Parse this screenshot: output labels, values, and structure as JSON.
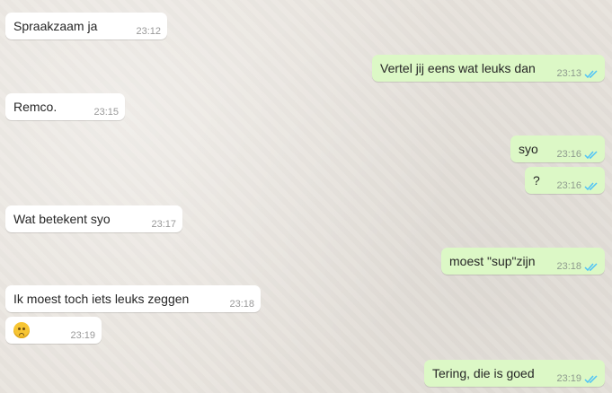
{
  "colors": {
    "incoming_bubble": "#ffffff",
    "outgoing_bubble": "#dcf8c6",
    "read_tick": "#4fc3f7"
  },
  "messages": [
    {
      "direction": "incoming",
      "text": "Spraakzaam ja",
      "time": "23:12"
    },
    {
      "direction": "outgoing",
      "text": "Vertel jij eens wat leuks dan",
      "time": "23:13",
      "status": "read"
    },
    {
      "direction": "incoming",
      "text": "Remco.",
      "time": "23:15"
    },
    {
      "direction": "outgoing",
      "text": "syo",
      "time": "23:16",
      "status": "read"
    },
    {
      "direction": "outgoing",
      "text": "?",
      "time": "23:16",
      "status": "read"
    },
    {
      "direction": "incoming",
      "text": "Wat betekent syo",
      "time": "23:17"
    },
    {
      "direction": "outgoing",
      "text": "moest \"sup\"zijn",
      "time": "23:18",
      "status": "read"
    },
    {
      "direction": "incoming",
      "text": "Ik moest toch iets leuks zeggen",
      "time": "23:18"
    },
    {
      "direction": "incoming",
      "emoji": "upside-down-face-emoji",
      "time": "23:19"
    },
    {
      "direction": "outgoing",
      "text": "Tering, die is goed",
      "time": "23:19",
      "status": "read"
    }
  ]
}
